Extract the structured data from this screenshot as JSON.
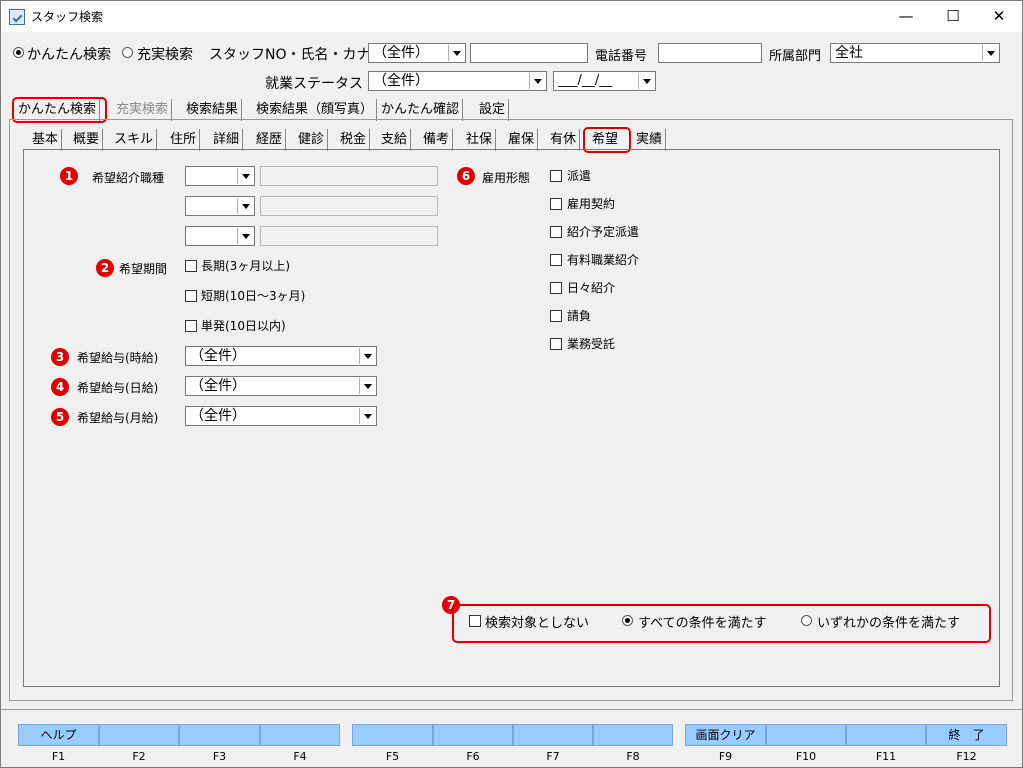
{
  "window": {
    "title": "スタッフ検索",
    "minimize": "—",
    "maximize": "☐",
    "close": "✕"
  },
  "search_bar": {
    "mode_simple": "かんたん検索",
    "mode_full": "充実検索",
    "staff_label": "スタッフNO・氏名・カナ",
    "staff_select": "（全件）",
    "phone_label": "電話番号",
    "dept_label": "所属部門",
    "dept_value": "全社",
    "status_label": "就業ステータス",
    "status_value": "（全件）",
    "date_value": "___/__/__"
  },
  "main_tabs": [
    "かんたん検索",
    "充実検索",
    "検索結果",
    "検索結果（顔写真）",
    "かんたん確認",
    "設定"
  ],
  "sub_tabs": [
    "基本",
    "概要",
    "スキル",
    "住所",
    "詳細",
    "経歴",
    "健診",
    "税金",
    "支給",
    "備考",
    "社保",
    "雇保",
    "有休",
    "希望",
    "実績"
  ],
  "form": {
    "job_label": "希望紹介職種",
    "period_label": "希望期間",
    "period_options": [
      "長期(3ヶ月以上)",
      "短期(10日～3ヶ月)",
      "単発(10日以内)"
    ],
    "hourly_label": "希望給与(時給)",
    "daily_label": "希望給与(日給)",
    "monthly_label": "希望給与(月給)",
    "salary_default": "（全件）",
    "employment_label": "雇用形態",
    "employment_options": [
      "派遣",
      "雇用契約",
      "紹介予定派遣",
      "有料職業紹介",
      "日々紹介",
      "請負",
      "業務受託"
    ],
    "condition_exclude": "検索対象としない",
    "condition_all": "すべての条件を満たす",
    "condition_any": "いずれかの条件を満たす"
  },
  "markers": [
    "1",
    "2",
    "3",
    "4",
    "5",
    "6",
    "7"
  ],
  "fkeys": [
    {
      "label": "ヘルプ",
      "key": "F1"
    },
    {
      "label": "",
      "key": "F2"
    },
    {
      "label": "",
      "key": "F3"
    },
    {
      "label": "",
      "key": "F4"
    },
    {
      "label": "",
      "key": "F5"
    },
    {
      "label": "",
      "key": "F6"
    },
    {
      "label": "",
      "key": "F7"
    },
    {
      "label": "",
      "key": "F8"
    },
    {
      "label": "画面クリア",
      "key": "F9"
    },
    {
      "label": "",
      "key": "F10"
    },
    {
      "label": "",
      "key": "F11"
    },
    {
      "label": "終　了",
      "key": "F12"
    }
  ],
  "colors": {
    "highlight": "#e00000",
    "fkey_bg": "#99ccff"
  }
}
